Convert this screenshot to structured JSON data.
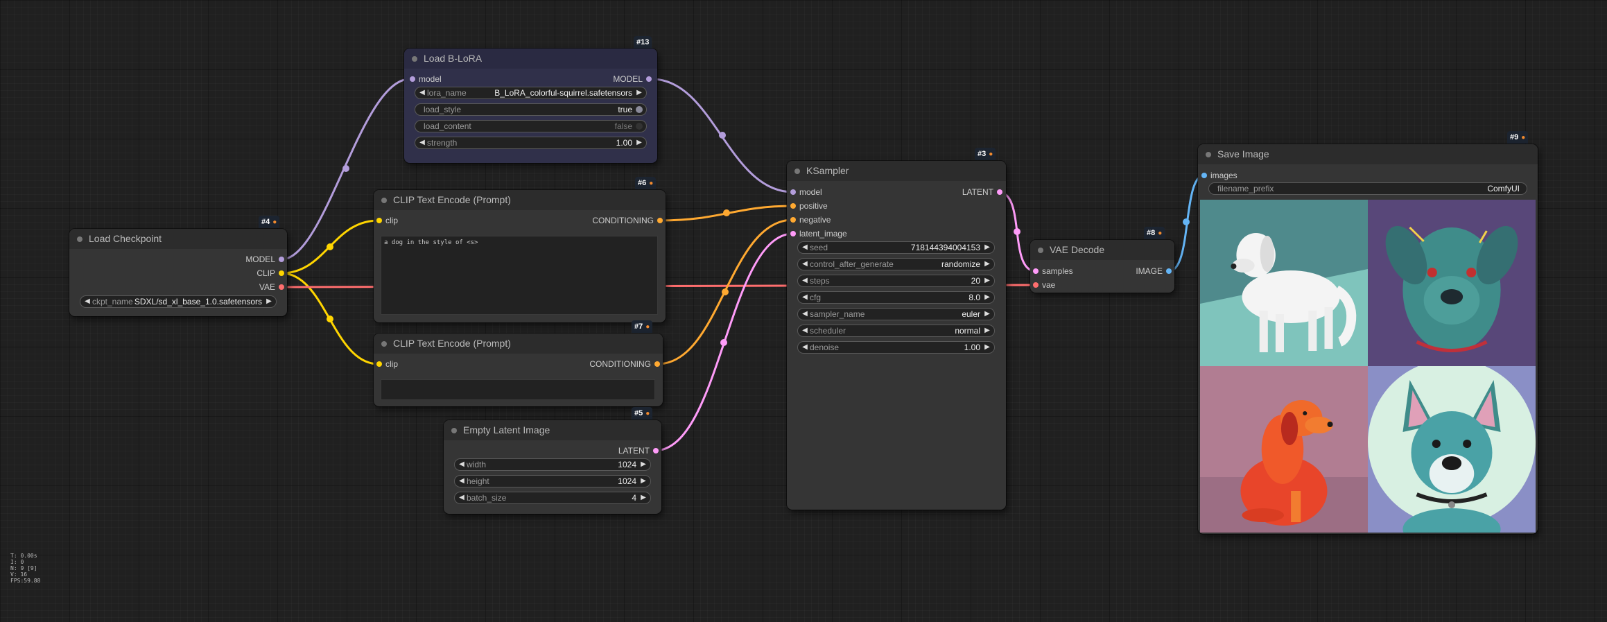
{
  "colors": {
    "model": "#b39ddb",
    "clip": "#ffd500",
    "vae": "#ff6e6e",
    "conditioning": "#ffa931",
    "latent": "#ff9cf9",
    "image": "#64b5f6"
  },
  "nodes": {
    "load_blora": {
      "title": "Load B-LoRA",
      "badge": "#13",
      "inputs": [
        "model"
      ],
      "outputs": [
        "MODEL"
      ],
      "widgets": {
        "lora_name": {
          "name": "lora_name",
          "value": "B_LoRA_colorful-squirrel.safetensors"
        },
        "load_style": {
          "name": "load_style",
          "value": "true"
        },
        "load_content": {
          "name": "load_content",
          "value": "false"
        },
        "strength": {
          "name": "strength",
          "value": "1.00"
        }
      }
    },
    "clip_pos": {
      "title": "CLIP Text Encode (Prompt)",
      "badge": "#6",
      "input": "clip",
      "output": "CONDITIONING",
      "text": "a dog in the style of <s>"
    },
    "clip_neg": {
      "title": "CLIP Text Encode (Prompt)",
      "badge": "#7",
      "input": "clip",
      "output": "CONDITIONING",
      "text": ""
    },
    "load_checkpoint": {
      "title": "Load Checkpoint",
      "badge": "#4",
      "outputs": [
        "MODEL",
        "CLIP",
        "VAE"
      ],
      "widget": {
        "name": "ckpt_name",
        "value": "SDXL/sd_xl_base_1.0.safetensors"
      }
    },
    "empty_latent": {
      "title": "Empty Latent Image",
      "badge": "#5",
      "output": "LATENT",
      "widgets": {
        "width": {
          "name": "width",
          "value": "1024"
        },
        "height": {
          "name": "height",
          "value": "1024"
        },
        "batch_size": {
          "name": "batch_size",
          "value": "4"
        }
      }
    },
    "ksampler": {
      "title": "KSampler",
      "badge": "#3",
      "inputs": [
        "model",
        "positive",
        "negative",
        "latent_image"
      ],
      "output": "LATENT",
      "widgets": {
        "seed": {
          "name": "seed",
          "value": "718144394004153"
        },
        "control_after_generate": {
          "name": "control_after_generate",
          "value": "randomize"
        },
        "steps": {
          "name": "steps",
          "value": "20"
        },
        "cfg": {
          "name": "cfg",
          "value": "8.0"
        },
        "sampler_name": {
          "name": "sampler_name",
          "value": "euler"
        },
        "scheduler": {
          "name": "scheduler",
          "value": "normal"
        },
        "denoise": {
          "name": "denoise",
          "value": "1.00"
        }
      }
    },
    "vae_decode": {
      "title": "VAE Decode",
      "badge": "#8",
      "inputs": [
        "samples",
        "vae"
      ],
      "output": "IMAGE"
    },
    "save_image": {
      "title": "Save Image",
      "badge": "#9",
      "input": "images",
      "widget": {
        "name": "filename_prefix",
        "value": "ComfyUI"
      },
      "images": [
        {
          "name": "white-dog-image",
          "bg": "#5a8c8c"
        },
        {
          "name": "teal-dog-portrait-image",
          "bg": "#5c4a7a"
        },
        {
          "name": "red-dog-sitting-image",
          "bg": "#b07a90"
        },
        {
          "name": "blue-dog-portrait-image",
          "bg": "#c8e8d8"
        }
      ]
    }
  },
  "stats": [
    "T: 0.00s",
    "I: 0",
    "N: 9 [9]",
    "V: 16",
    "FPS:59.88"
  ]
}
